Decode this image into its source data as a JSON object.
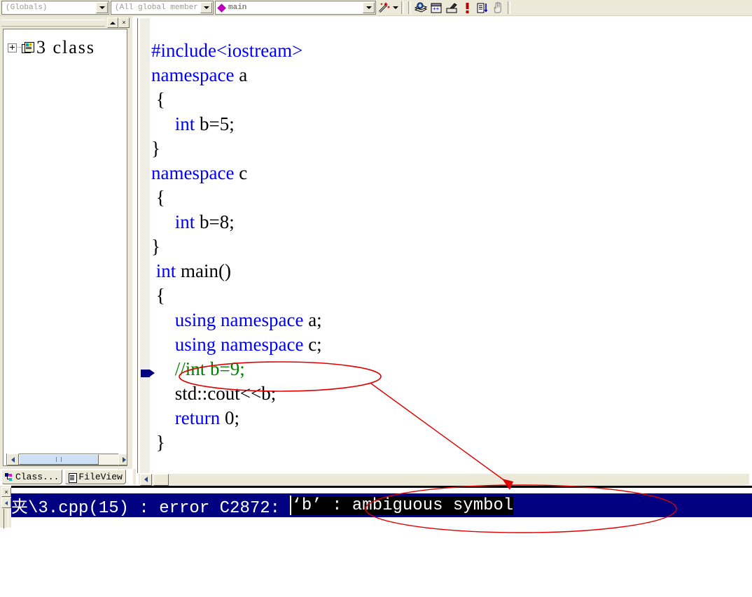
{
  "window": {
    "app": "Microsoft Visual C++",
    "accent_selection": "#000080",
    "annotation_color": "#ff0000"
  },
  "toolbar": {
    "combo_class": {
      "value": "(Globals)",
      "name": "class-combo"
    },
    "combo_member": {
      "value": "(All global member",
      "name": "member-combo"
    },
    "combo_symbol": {
      "value": "main",
      "icon": "magenta-diamond-icon"
    },
    "buttons": [
      {
        "name": "wizardbar-button",
        "icon": "magic-wand-icon"
      },
      {
        "name": "wizardbar-dropdown",
        "icon": "chevron-down-icon"
      },
      {
        "name": "compile-button",
        "icon": "compile-icon"
      },
      {
        "name": "build-button",
        "icon": "build-icon"
      },
      {
        "name": "stop-build-button",
        "icon": "stop-build-icon"
      },
      {
        "name": "error-button",
        "icon": "exclamation-icon"
      },
      {
        "name": "go-button",
        "icon": "document-arrow-icon"
      },
      {
        "name": "pause-button",
        "icon": "hand-icon"
      }
    ]
  },
  "workspace": {
    "panel_buttons": [
      {
        "name": "panel-minimize-button",
        "label": ""
      },
      {
        "name": "panel-close-button",
        "label": "×"
      }
    ],
    "tree": {
      "root": {
        "label": "3 class",
        "icon": "class-folder-icon",
        "expander": "+"
      }
    },
    "tabs": [
      {
        "label": "Class...",
        "icon": "classview-icon",
        "active": true
      },
      {
        "label": "FileView",
        "icon": "fileview-icon",
        "active": false
      }
    ],
    "hscroll": {
      "name": "workspace-hscrollbar"
    }
  },
  "editor": {
    "lines": [
      {
        "indent": 0,
        "tokens": [
          {
            "t": "#include<iostream>",
            "c": "kw"
          }
        ]
      },
      {
        "indent": 0,
        "tokens": [
          {
            "t": "namespace",
            "c": "kw"
          },
          {
            "t": " a",
            "c": "pl"
          }
        ]
      },
      {
        "indent": 0,
        "tokens": [
          {
            "t": " {",
            "c": "pl"
          }
        ]
      },
      {
        "indent": 0,
        "tokens": [
          {
            "t": "     ",
            "c": "pl"
          },
          {
            "t": "int",
            "c": "kw"
          },
          {
            "t": " b=5;",
            "c": "pl"
          }
        ]
      },
      {
        "indent": 0,
        "tokens": [
          {
            "t": "}",
            "c": "pl"
          }
        ]
      },
      {
        "indent": 0,
        "tokens": [
          {
            "t": "namespace",
            "c": "kw"
          },
          {
            "t": " c",
            "c": "pl"
          }
        ]
      },
      {
        "indent": 0,
        "tokens": [
          {
            "t": " {",
            "c": "pl"
          }
        ]
      },
      {
        "indent": 0,
        "tokens": [
          {
            "t": "     ",
            "c": "pl"
          },
          {
            "t": "int",
            "c": "kw"
          },
          {
            "t": " b=8;",
            "c": "pl"
          }
        ]
      },
      {
        "indent": 0,
        "tokens": [
          {
            "t": "}",
            "c": "pl"
          }
        ]
      },
      {
        "indent": 0,
        "tokens": [
          {
            "t": " ",
            "c": "pl"
          },
          {
            "t": "int",
            "c": "kw"
          },
          {
            "t": " main()",
            "c": "pl"
          }
        ]
      },
      {
        "indent": 0,
        "tokens": [
          {
            "t": " {",
            "c": "pl"
          }
        ]
      },
      {
        "indent": 0,
        "tokens": [
          {
            "t": "     ",
            "c": "pl"
          },
          {
            "t": "using namespace",
            "c": "kw"
          },
          {
            "t": " a;",
            "c": "pl"
          }
        ]
      },
      {
        "indent": 0,
        "tokens": [
          {
            "t": "     ",
            "c": "pl"
          },
          {
            "t": "using namespace",
            "c": "kw"
          },
          {
            "t": " c;",
            "c": "pl"
          }
        ]
      },
      {
        "indent": 0,
        "tokens": [
          {
            "t": "     //int b=9;",
            "c": "cm"
          }
        ]
      },
      {
        "indent": 0,
        "tokens": [
          {
            "t": "     std::cout<<b;",
            "c": "pl"
          }
        ]
      },
      {
        "indent": 0,
        "tokens": [
          {
            "t": "     ",
            "c": "pl"
          },
          {
            "t": "return",
            "c": "kw"
          },
          {
            "t": " 0;",
            "c": "pl"
          }
        ]
      },
      {
        "indent": 0,
        "tokens": [
          {
            "t": " }",
            "c": "pl"
          }
        ]
      }
    ],
    "gutter_marker": {
      "name": "bookmark-marker",
      "line": 15,
      "color": "#000080"
    },
    "hscroll": {
      "name": "editor-hscrollbar"
    }
  },
  "output": {
    "close_button": "×",
    "error": {
      "prefix": "夹\\3.cpp(15) : error C2872: ",
      "selected": "‘b’ : ambiguous symbol",
      "full": "夹\\3.cpp(15) : error C2872: ‘b’ : ambiguous symbol"
    }
  },
  "annotations": {
    "ellipse_code_label": "circle-around-cout-line",
    "ellipse_error_label": "circle-around-error-text",
    "arrow_label": "arrow-code-to-error"
  }
}
